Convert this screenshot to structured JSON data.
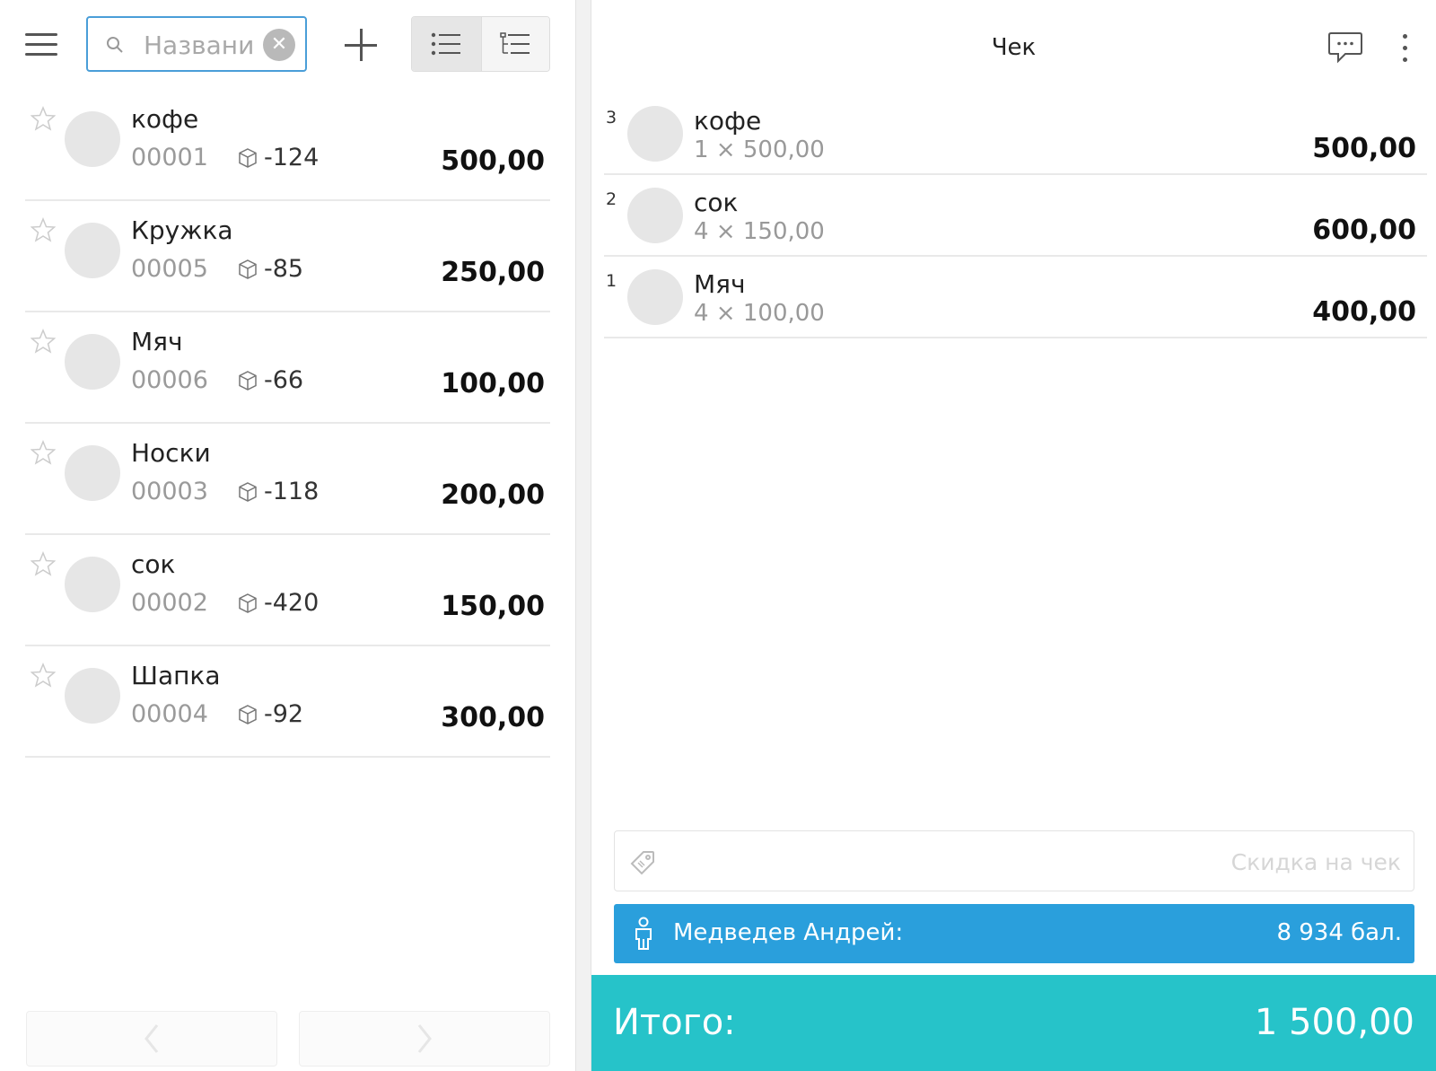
{
  "toolbar": {
    "search_placeholder": "Названи",
    "clear_symbol": "✕"
  },
  "products": [
    {
      "name": "кофе",
      "code": "00001",
      "stock": "-124",
      "price": "500,00"
    },
    {
      "name": "Кружка",
      "code": "00005",
      "stock": "-85",
      "price": "250,00"
    },
    {
      "name": "Мяч",
      "code": "00006",
      "stock": "-66",
      "price": "100,00"
    },
    {
      "name": "Носки",
      "code": "00003",
      "stock": "-118",
      "price": "200,00"
    },
    {
      "name": "сок",
      "code": "00002",
      "stock": "-420",
      "price": "150,00"
    },
    {
      "name": "Шапка",
      "code": "00004",
      "stock": "-92",
      "price": "300,00"
    }
  ],
  "receipt": {
    "title": "Чек",
    "items": [
      {
        "index": "3",
        "name": "кофе",
        "qty": "1 × 500,00",
        "sum": "500,00"
      },
      {
        "index": "2",
        "name": "сок",
        "qty": "4 × 150,00",
        "sum": "600,00"
      },
      {
        "index": "1",
        "name": "Мяч",
        "qty": "4 × 100,00",
        "sum": "400,00"
      }
    ],
    "discount_placeholder": "Скидка на чек",
    "customer": {
      "name": "Медведев Андрей:",
      "points": "8 934 бал."
    },
    "total": {
      "label": "Итого:",
      "value": "1 500,00"
    }
  },
  "icons": {
    "menu": "hamburger-icon",
    "search": "search-icon",
    "add": "plus-icon",
    "list_view": "list-icon",
    "tree_view": "tree-list-icon",
    "favorite": "star-icon",
    "stock": "box-icon",
    "comment": "chat-icon",
    "more": "more-vertical-icon",
    "discount": "tag-icon",
    "customer": "person-icon",
    "prev": "chevron-left-icon",
    "next": "chevron-right-icon"
  },
  "colors": {
    "accent": "#2a9fdc",
    "total_bar": "#26c3c9",
    "search_border": "#4a9ed8"
  }
}
